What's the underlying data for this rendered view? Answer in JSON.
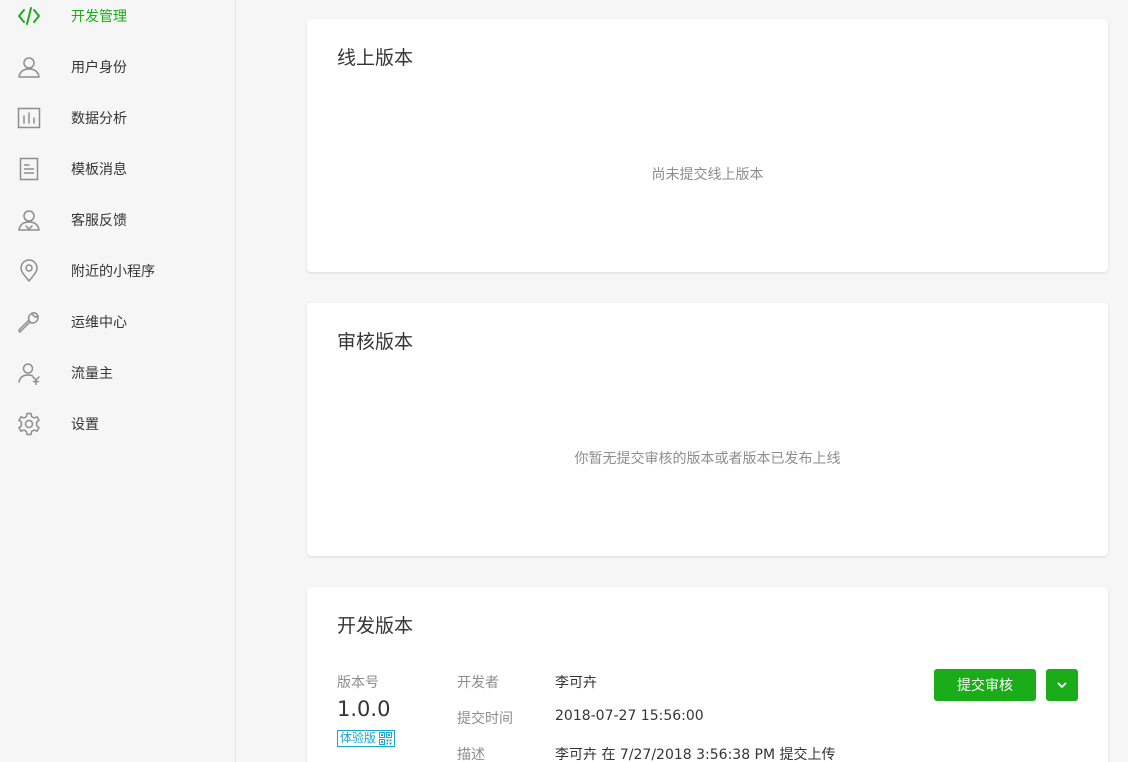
{
  "colors": {
    "accent": "#1aad19",
    "badge": "#1aa6cf",
    "muted_text": "#8d8d8d",
    "text": "#353535",
    "background": "#f6f6f6",
    "card": "#ffffff"
  },
  "sidebar": {
    "items": [
      {
        "label": "开发管理",
        "icon": "code-icon",
        "active": true
      },
      {
        "label": "用户身份",
        "icon": "user-icon",
        "active": false
      },
      {
        "label": "数据分析",
        "icon": "bar-chart-icon",
        "active": false
      },
      {
        "label": "模板消息",
        "icon": "document-icon",
        "active": false
      },
      {
        "label": "客服反馈",
        "icon": "customer-service-icon",
        "active": false
      },
      {
        "label": "附近的小程序",
        "icon": "location-pin-icon",
        "active": false
      },
      {
        "label": "运维中心",
        "icon": "wrench-icon",
        "active": false
      },
      {
        "label": "流量主",
        "icon": "user-yen-icon",
        "active": false
      },
      {
        "label": "设置",
        "icon": "gear-icon",
        "active": false
      }
    ]
  },
  "online_version": {
    "title": "线上版本",
    "empty_text": "尚未提交线上版本"
  },
  "review_version": {
    "title": "审核版本",
    "empty_text": "你暂无提交审核的版本或者版本已发布上线"
  },
  "dev_version": {
    "title": "开发版本",
    "version_label": "版本号",
    "version_number": "1.0.0",
    "trial_badge": "体验版",
    "developer_label": "开发者",
    "developer_value": "李可卉",
    "submit_time_label": "提交时间",
    "submit_time_value": "2018-07-27 15:56:00",
    "description_label": "描述",
    "description_value": "李可卉 在 7/27/2018 3:56:38 PM 提交上传",
    "submit_review_button": "提交审核"
  }
}
